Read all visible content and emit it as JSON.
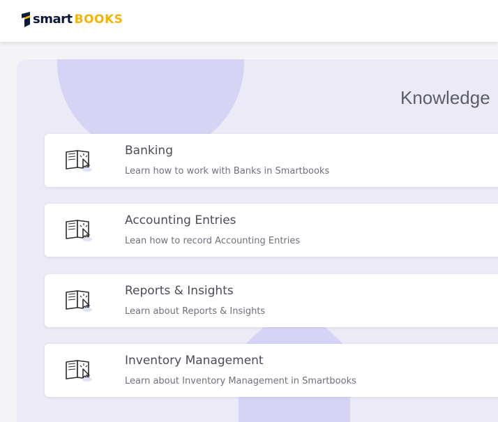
{
  "header": {
    "logo_smart": "smart",
    "logo_books": "BOOKS"
  },
  "panel": {
    "title": "Knowledge"
  },
  "cards": [
    {
      "title": "Banking",
      "description": "Learn how to work with Banks in Smartbooks",
      "icon": "book-pointer-icon"
    },
    {
      "title": "Accounting Entries",
      "description": "Lean how to record Accounting Entries",
      "icon": "book-pointer-icon"
    },
    {
      "title": "Reports & Insights",
      "description": "Learn about Reports & Insights",
      "icon": "book-pointer-icon"
    },
    {
      "title": "Inventory Management",
      "description": "Learn about Inventory Management in Smartbooks",
      "icon": "book-pointer-icon"
    }
  ],
  "colors": {
    "brand_dark": "#0b1a3a",
    "brand_accent": "#f5b400",
    "panel_bg": "#ebeaf6",
    "blob": "#d6d4f5"
  }
}
